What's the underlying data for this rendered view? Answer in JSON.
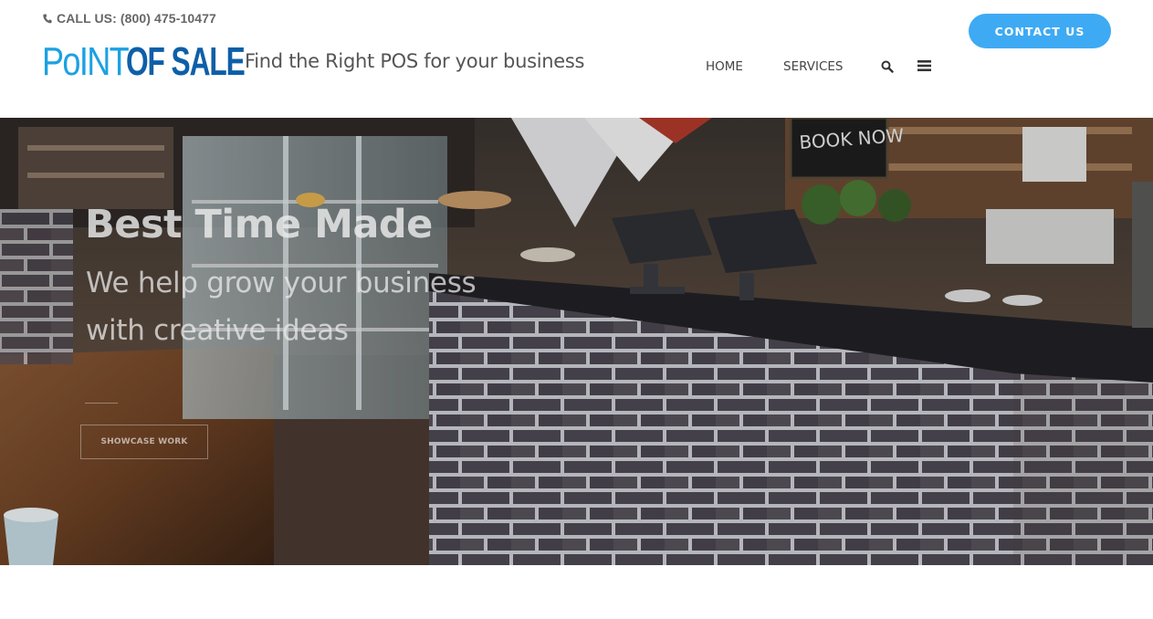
{
  "header": {
    "call_us": "CALL US: (800) 475-10477",
    "logo": {
      "part1": "PoINT",
      "part2": "OF SALE"
    },
    "tagline": "Find the Right POS for your business",
    "nav": {
      "home": "HOME",
      "services": "SERVICES"
    },
    "icons": {
      "phone": "phone-icon",
      "search": "search-icon",
      "menu": "hamburger-menu-icon"
    },
    "contact_label": "CONTACT US",
    "colors": {
      "accent": "#3eaaf3",
      "logo_light": "#1ba1e2",
      "logo_dark": "#0e5fa8"
    }
  },
  "hero": {
    "title": "Best Time Made",
    "subtitle": "We help grow your business with creative ideas",
    "button_label": "SHOWCASE WORK",
    "sign_text": "BOOK NOW"
  }
}
